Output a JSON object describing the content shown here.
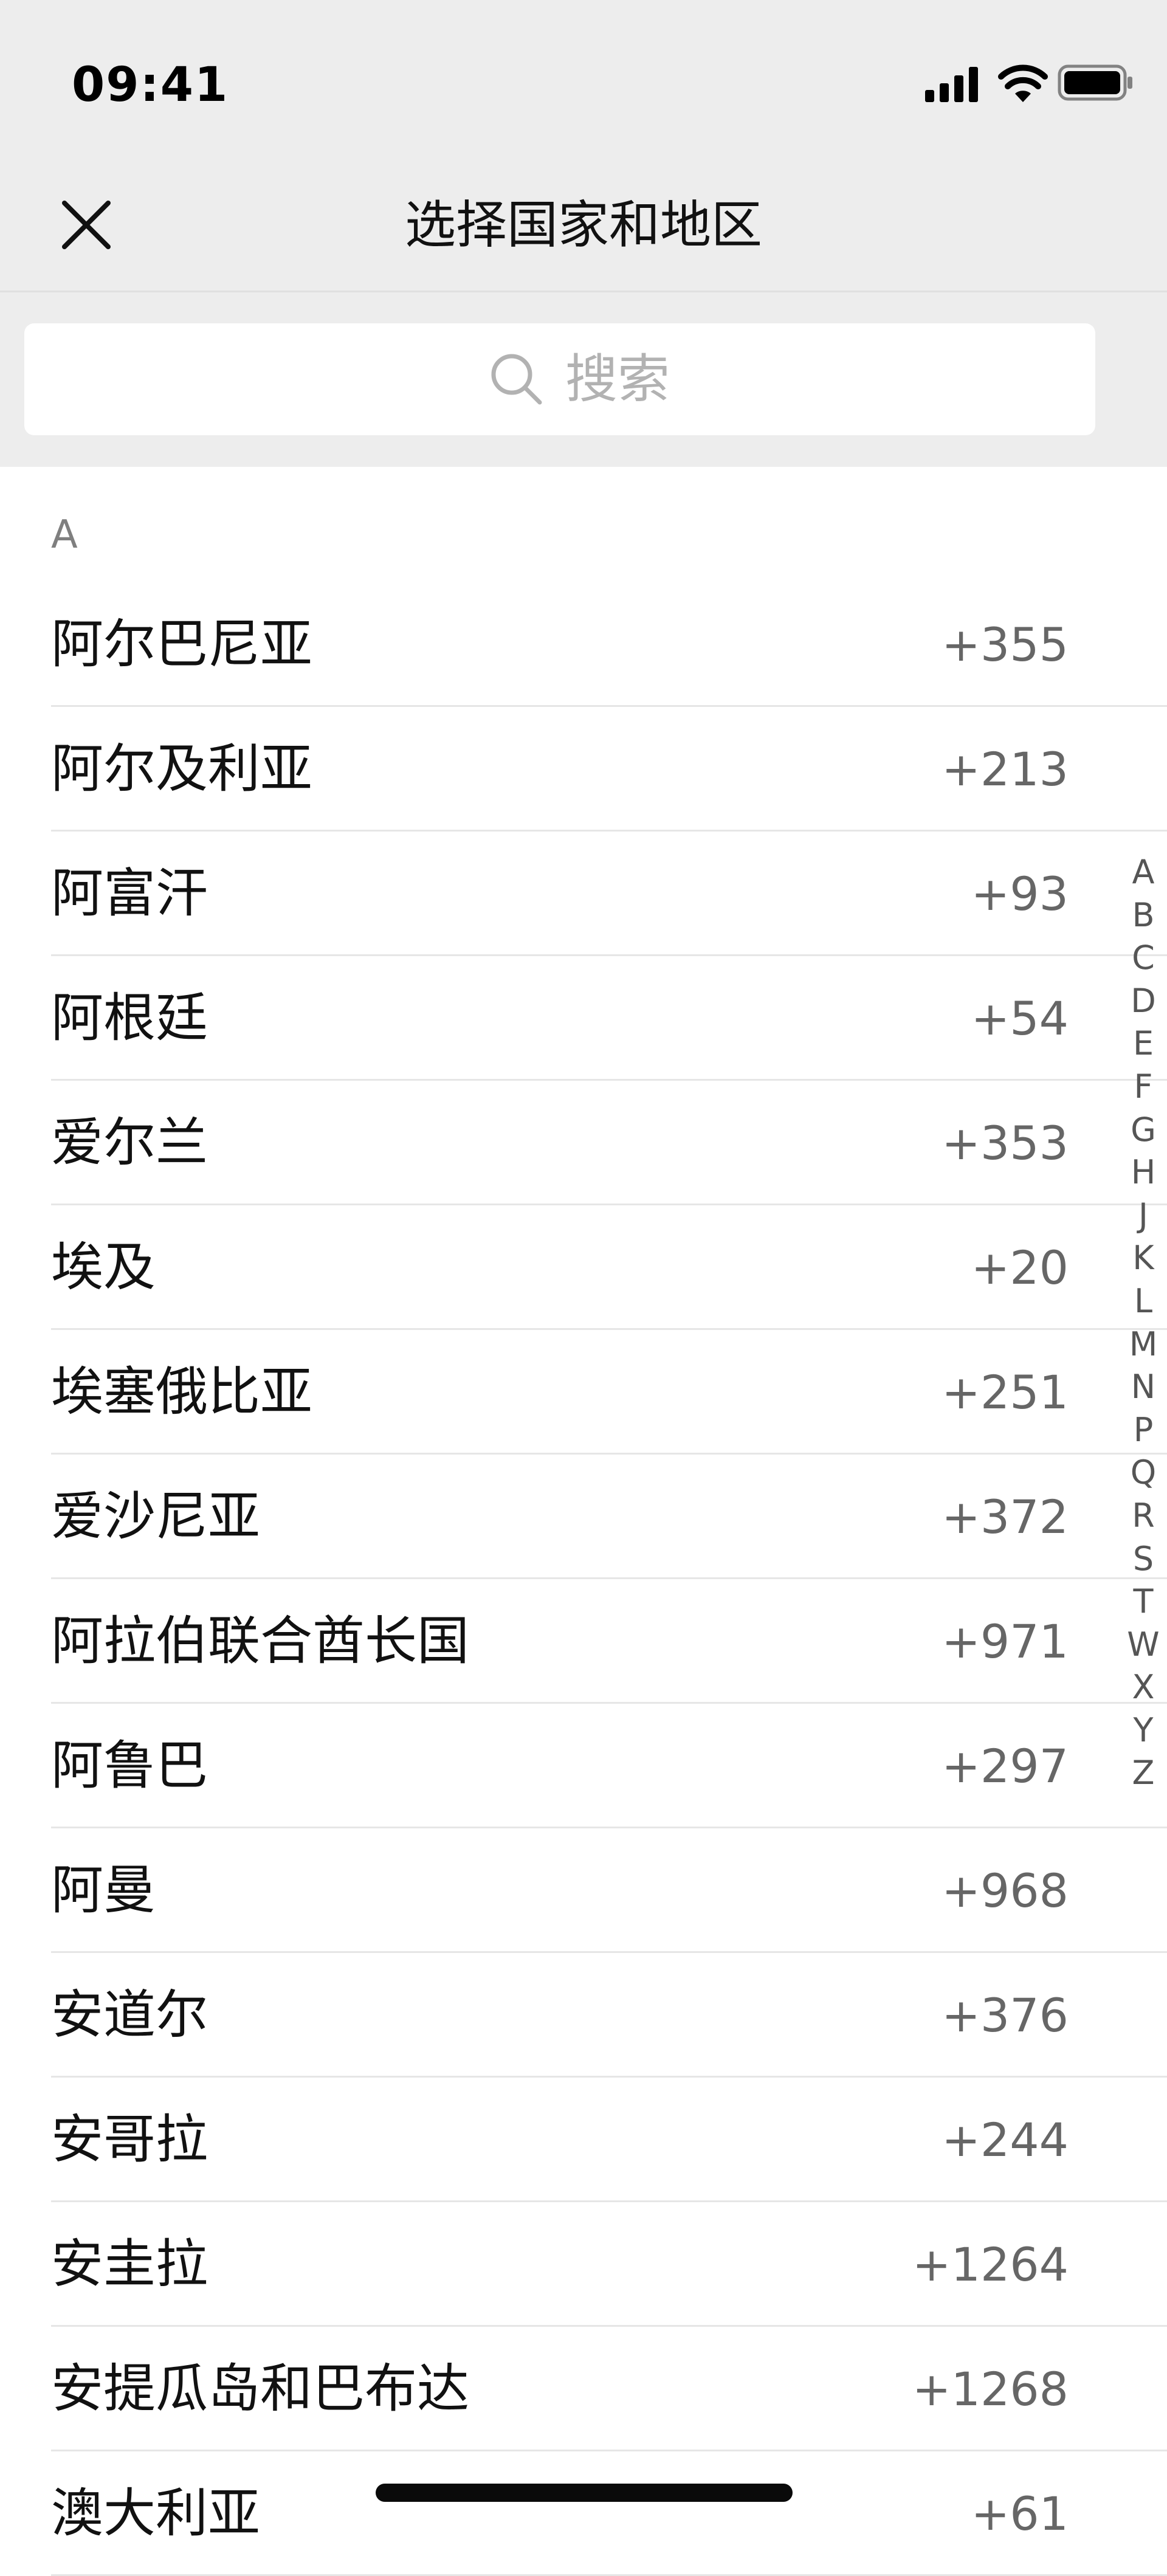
{
  "status_bar": {
    "time": "09:41"
  },
  "nav": {
    "title": "选择国家和地区"
  },
  "search": {
    "placeholder": "搜索"
  },
  "section": {
    "header": "A"
  },
  "countries": [
    {
      "name": "阿尔巴尼亚",
      "code": "+355"
    },
    {
      "name": "阿尔及利亚",
      "code": "+213"
    },
    {
      "name": "阿富汗",
      "code": "+93"
    },
    {
      "name": "阿根廷",
      "code": "+54"
    },
    {
      "name": "爱尔兰",
      "code": "+353"
    },
    {
      "name": "埃及",
      "code": "+20"
    },
    {
      "name": "埃塞俄比亚",
      "code": "+251"
    },
    {
      "name": "爱沙尼亚",
      "code": "+372"
    },
    {
      "name": "阿拉伯联合酋长国",
      "code": "+971"
    },
    {
      "name": "阿鲁巴",
      "code": "+297"
    },
    {
      "name": "阿曼",
      "code": "+968"
    },
    {
      "name": "安道尔",
      "code": "+376"
    },
    {
      "name": "安哥拉",
      "code": "+244"
    },
    {
      "name": "安圭拉",
      "code": "+1264"
    },
    {
      "name": "安提瓜岛和巴布达",
      "code": "+1268"
    },
    {
      "name": "澳大利亚",
      "code": "+61"
    }
  ],
  "index_letters": [
    "A",
    "B",
    "C",
    "D",
    "E",
    "F",
    "G",
    "H",
    "J",
    "K",
    "L",
    "M",
    "N",
    "P",
    "Q",
    "R",
    "S",
    "T",
    "W",
    "X",
    "Y",
    "Z"
  ],
  "colors": {
    "header_bg": "#ededed",
    "text": "#111111",
    "secondary": "#666666",
    "divider": "#e6e6e6"
  }
}
